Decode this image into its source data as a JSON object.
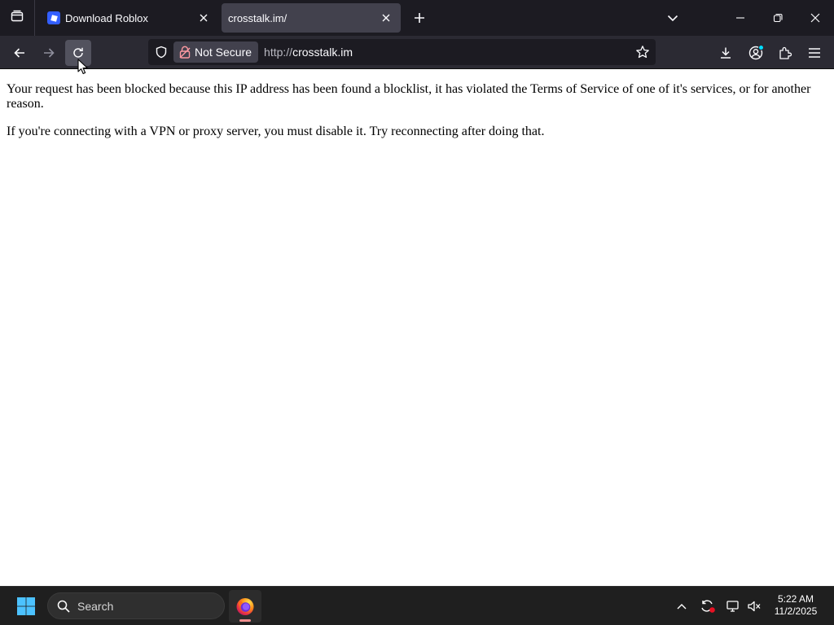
{
  "browser": {
    "tabs": [
      {
        "title": "Download Roblox",
        "active": false,
        "favicon": "roblox-icon"
      },
      {
        "title": "crosstalk.im/",
        "active": true,
        "favicon": "none"
      }
    ],
    "toolbar_icons": [
      "tab-list-icon",
      "plus-icon",
      "chevron-down-icon",
      "minimize-icon",
      "restore-icon",
      "close-icon"
    ]
  },
  "navbar": {
    "security_label": "Not Secure",
    "url_scheme": "http://",
    "url_host": "crosstalk.im",
    "icons": [
      "back-arrow-icon",
      "forward-arrow-icon",
      "reload-icon",
      "shield-icon",
      "lock-warning-icon",
      "star-icon",
      "download-icon",
      "account-icon",
      "extensions-icon",
      "hamburger-menu-icon"
    ]
  },
  "page": {
    "paragraph1": "Your request has been blocked because this IP address has been found a blocklist, it has violated the Terms of Service of one of it's services, or for another reason.",
    "paragraph2": "If you're connecting with a VPN or proxy server, you must disable it. Try reconnecting after doing that."
  },
  "taskbar": {
    "search_placeholder": "Search",
    "time": "5:22 AM",
    "date": "11/2/2025",
    "accent_colors": {
      "windows_logo": "#4cc2ff",
      "firefox_indicator": "#f08e8e",
      "sync_badge": "#e81123"
    }
  }
}
